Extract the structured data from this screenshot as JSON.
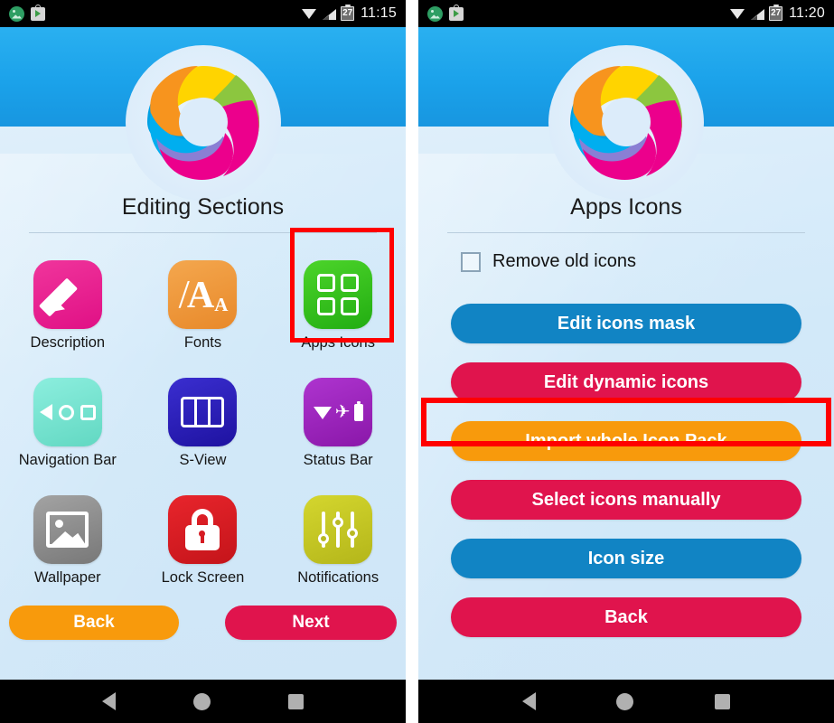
{
  "left_phone": {
    "status_bar": {
      "notification_icons": [
        "photos-icon",
        "play-store-icon"
      ],
      "wifi": "wifi-icon",
      "signal": "signal-icon",
      "battery_level": "27",
      "time": "11:15"
    },
    "logo": "app-logo-ring",
    "title": "Editing Sections",
    "grid": [
      {
        "label": "Description",
        "icon": "pencil-icon",
        "color": "#ec1b8c"
      },
      {
        "label": "Fonts",
        "icon": "fonts-icon",
        "color": "#ef9336"
      },
      {
        "label": "Apps Icons",
        "icon": "grid-icon",
        "color": "#35c21b",
        "highlighted": true
      },
      {
        "label": "Navigation Bar",
        "icon": "navbar-icon",
        "color": "#79e3d0"
      },
      {
        "label": "S-View",
        "icon": "sview-icon",
        "color": "#2a1fb5"
      },
      {
        "label": "Status Bar",
        "icon": "statusbar-icon",
        "color": "#9c22bd"
      },
      {
        "label": "Wallpaper",
        "icon": "image-icon",
        "color": "#8e8e8e"
      },
      {
        "label": "Lock Screen",
        "icon": "lock-icon",
        "color": "#d51b22"
      },
      {
        "label": "Notifications",
        "icon": "sliders-icon",
        "color": "#c6c822"
      }
    ],
    "footer": {
      "back_label": "Back",
      "back_color": "#f89a0c",
      "next_label": "Next",
      "next_color": "#e0144d"
    },
    "nav_bar": {
      "back": "back-triangle-icon",
      "home": "home-circle-icon",
      "recents": "recents-square-icon"
    }
  },
  "right_phone": {
    "status_bar": {
      "notification_icons": [
        "photos-icon",
        "play-store-icon"
      ],
      "wifi": "wifi-icon",
      "signal": "signal-icon",
      "battery_level": "27",
      "time": "11:20"
    },
    "logo": "app-logo-ring",
    "title": "Apps Icons",
    "checkbox": {
      "label": "Remove old icons",
      "checked": false
    },
    "buttons": [
      {
        "label": "Edit icons mask",
        "color": "#1184c4"
      },
      {
        "label": "Edit dynamic icons",
        "color": "#e0144d"
      },
      {
        "label": "Import whole Icon Pack",
        "color": "#f89a0c",
        "highlighted": true
      },
      {
        "label": "Select icons manually",
        "color": "#e0144d"
      },
      {
        "label": "Icon size",
        "color": "#1184c4"
      },
      {
        "label": "Back",
        "color": "#e0144d"
      }
    ],
    "nav_bar": {
      "back": "back-triangle-icon",
      "home": "home-circle-icon",
      "recents": "recents-square-icon"
    }
  },
  "highlight_color": "#ff0000"
}
